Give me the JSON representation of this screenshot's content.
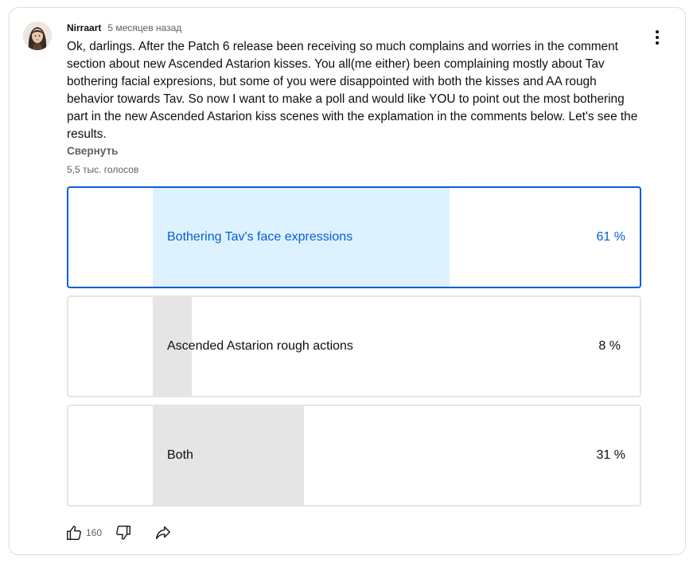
{
  "comment": {
    "author": "Nirraart",
    "time": "5 месяцев назад",
    "text": "Ok, darlings. After the Patch 6 release been receiving so much complains and worries in the comment section about new Ascended Astarion kisses. You all(me either) been complaining mostly about Tav bothering facial expresions, but some of you were disappointed with both the kisses and AA rough behavior towards Tav. So now I want to make a poll and would like YOU to point out the most bothering part in the new Ascended Astarion kiss scenes with the explamation in the comments below. Let's see the results.",
    "collapse_label": "Свернуть",
    "menu_icon": "more-vertical-icon"
  },
  "poll": {
    "votes_label": "5,5 тыс. голосов",
    "options": [
      {
        "label": "Bothering Tav's face expressions",
        "percent_label": "61 %",
        "percent": 61,
        "selected": true
      },
      {
        "label": "Ascended Astarion rough actions",
        "percent_label": "8 %",
        "percent": 8,
        "selected": false
      },
      {
        "label": "Both",
        "percent_label": "31 %",
        "percent": 31,
        "selected": false
      }
    ]
  },
  "actions": {
    "like_count": "160",
    "like_icon": "thumbs-up-icon",
    "dislike_icon": "thumbs-down-icon",
    "share_icon": "share-icon"
  },
  "colors": {
    "selected_border": "#065fd4",
    "selected_fill": "#def1ff",
    "unselected_fill": "#e5e5e5",
    "selected_text": "#065fd4"
  }
}
